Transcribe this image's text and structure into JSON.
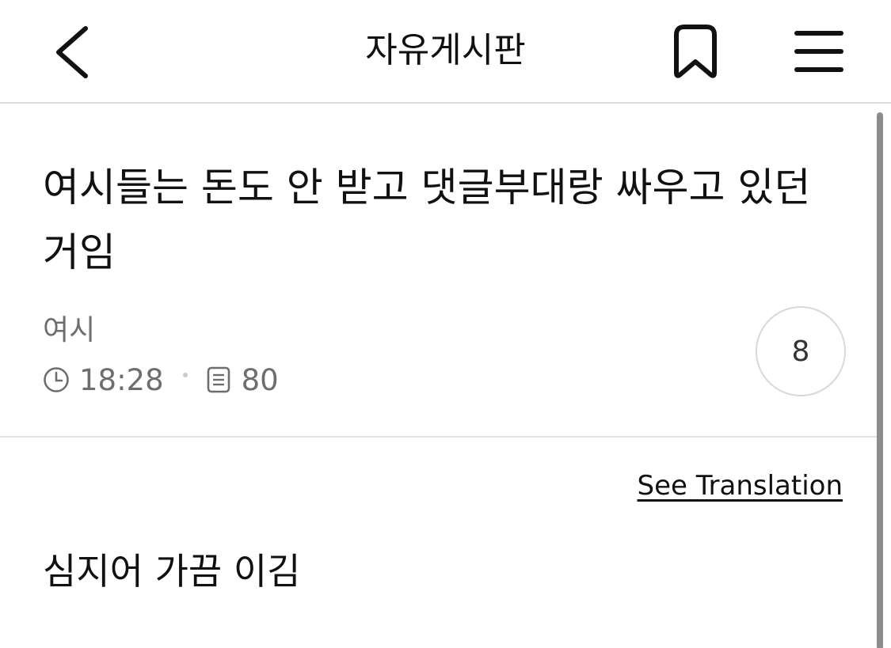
{
  "header": {
    "title": "자유게시판",
    "back_icon": "chevron-left-icon",
    "bookmark_icon": "bookmark-icon",
    "menu_icon": "hamburger-menu-icon"
  },
  "post": {
    "title": "여시들는 돈도 안 받고 댓글부대랑 싸우고 있던거임",
    "author": "여시",
    "time": "18:28",
    "views": "80",
    "comment_count": "8",
    "see_translation": "See Translation",
    "body": "심지어 가끔 이김"
  }
}
